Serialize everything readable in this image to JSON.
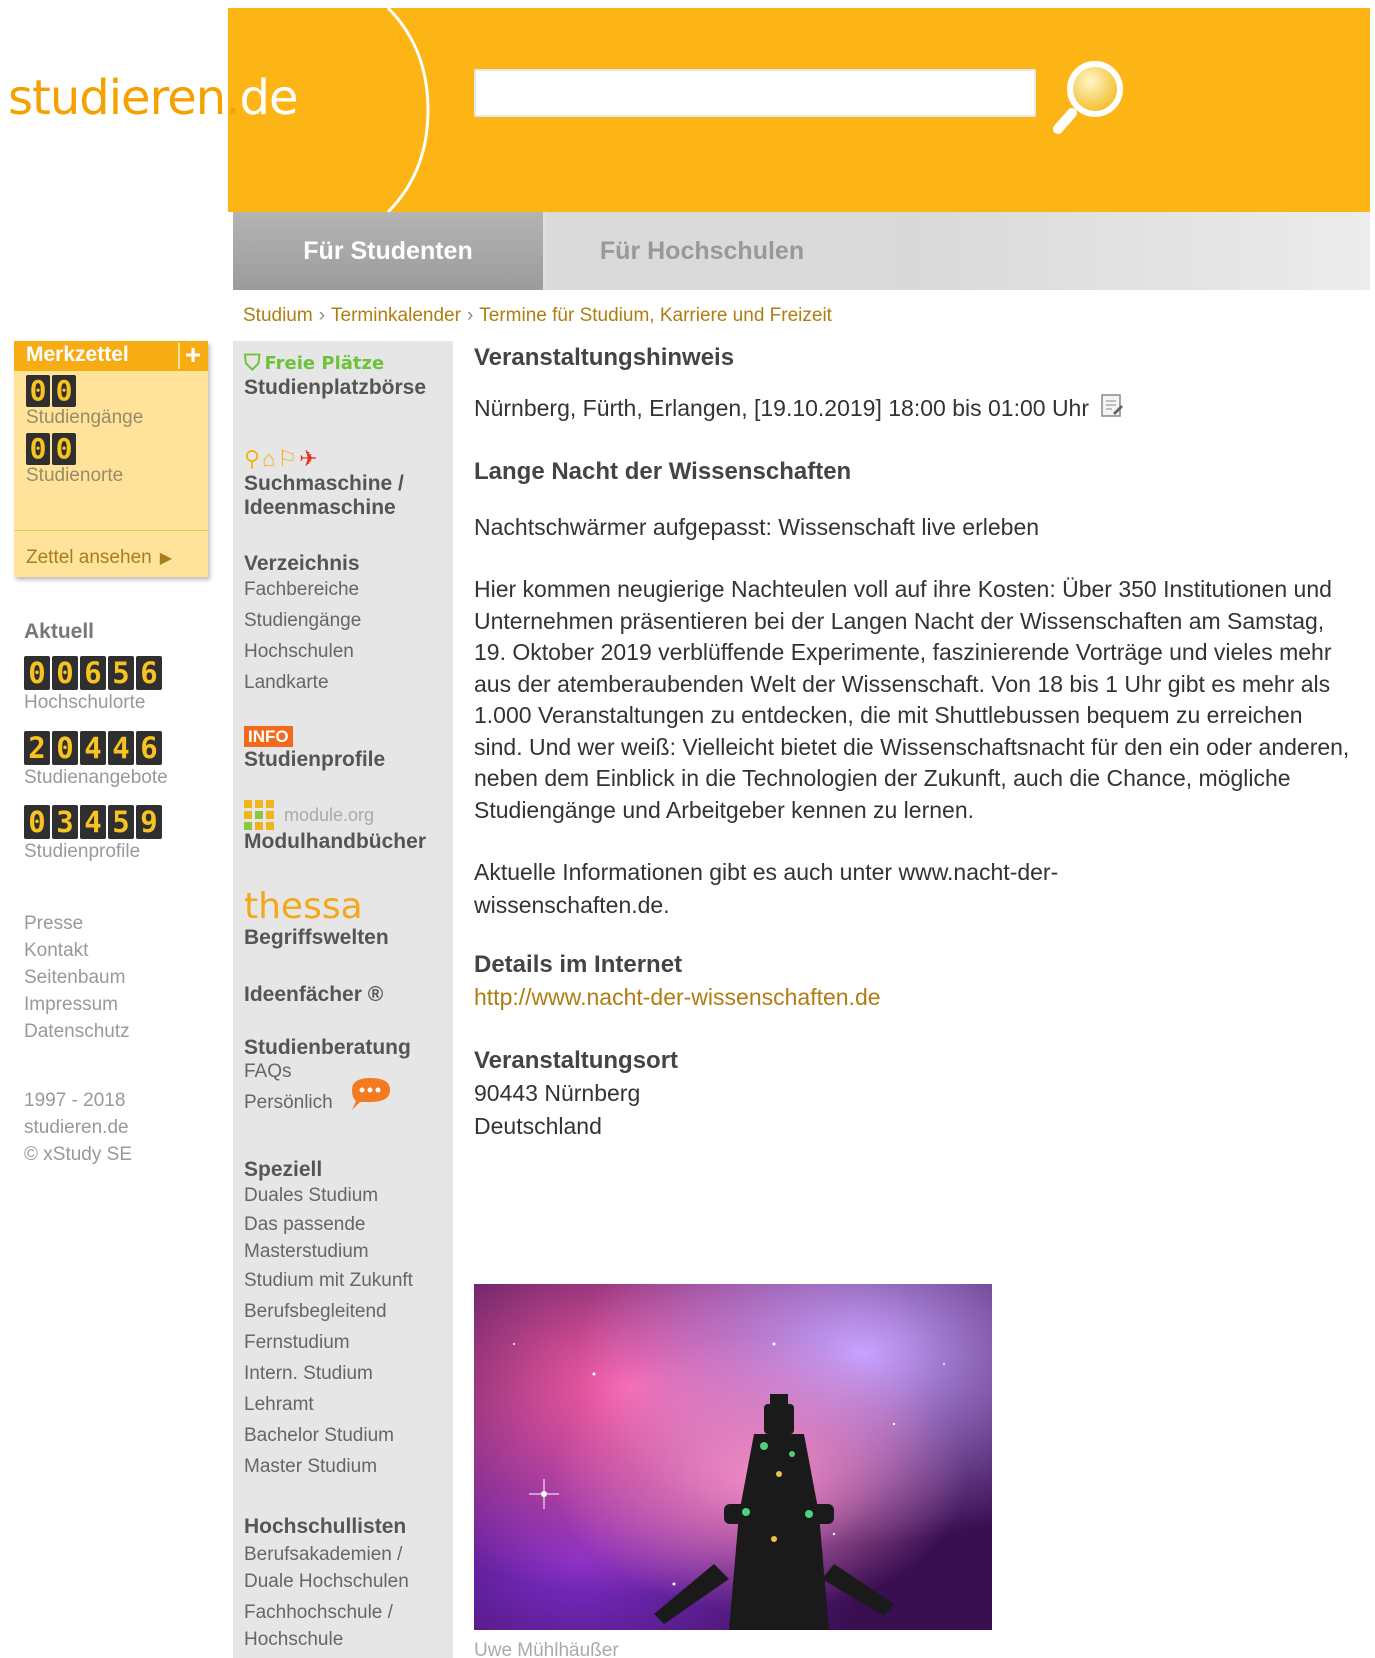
{
  "header": {
    "logo_main": "studieren.",
    "logo_tld": "de",
    "search_placeholder": ""
  },
  "tabs": [
    {
      "label": "Für Studenten",
      "active": true
    },
    {
      "label": "Für Hochschulen",
      "active": false
    }
  ],
  "breadcrumb": [
    "Studium",
    "Terminkalender",
    "Termine für Studium, Karriere und Freizeit"
  ],
  "merkzettel": {
    "title": "Merkzettel",
    "plus": "+",
    "studiengaenge_count": "00",
    "studiengaenge_label": "Studiengänge",
    "studienorte_count": "00",
    "studienorte_label": "Studienorte",
    "link": "Zettel ansehen"
  },
  "aktuell": {
    "title": "Aktuell",
    "stats": [
      {
        "value": "00656",
        "label": "Hochschulorte"
      },
      {
        "value": "20446",
        "label": "Studienangebote"
      },
      {
        "value": "03459",
        "label": "Studienprofile"
      }
    ]
  },
  "footer_links": [
    "Presse",
    "Kontakt",
    "Seitenbaum",
    "Impressum",
    "Datenschutz"
  ],
  "copyright": [
    "1997 - 2018",
    "studieren.de",
    "© xStudy SE"
  ],
  "nav": {
    "freie_plaetze": "Freie Plätze",
    "studienplatzboerse": "Studienplatzbörse",
    "suchmaschine": "Suchmaschine /",
    "ideenmaschine": "Ideenmaschine",
    "verzeichnis": {
      "title": "Verzeichnis",
      "items": [
        "Fachbereiche",
        "Studiengänge",
        "Hochschulen",
        "Landkarte"
      ]
    },
    "info_badge": "INFO",
    "studienprofile": "Studienprofile",
    "module_org": "module.org",
    "modulhandbuecher": "Modulhandbücher",
    "thessa": "thessa",
    "begriffswelten": "Begriffswelten",
    "ideenfaecher": "Ideenfächer ®",
    "studienberatung": {
      "title": "Studienberatung",
      "items": [
        "FAQs",
        "Persönlich"
      ]
    },
    "speziell": {
      "title": "Speziell",
      "items": [
        "Duales Studium",
        "Das passende Masterstudium",
        "Studium mit Zukunft",
        "Berufsbegleitend",
        "Fernstudium",
        "Intern. Studium",
        "Lehramt",
        "Bachelor Studium",
        "Master Studium"
      ]
    },
    "hochschullisten": {
      "title": "Hochschullisten",
      "items": [
        "Berufsakademien / Duale Hochschulen",
        "Fachhochschule / Hochschule"
      ]
    }
  },
  "event": {
    "heading": "Veranstaltungshinweis",
    "when": "Nürnberg, Fürth, Erlangen, [19.10.2019] 18:00 bis 01:00 Uhr",
    "title": "Lange Nacht der Wissenschaften",
    "subtitle": "Nachtschwärmer aufgepasst: Wissenschaft live erleben",
    "body": "Hier kommen neugierige Nachteulen voll auf ihre Kosten: Über 350 Institutionen und Unternehmen präsentieren bei der Langen Nacht der Wissenschaften am Samstag, 19. Oktober 2019 verblüffende Experimente, faszinierende Vorträge und vieles mehr aus der atemberaubenden Welt der Wissenschaft. Von 18 bis 1 Uhr gibt es mehr als 1.000 Veranstaltungen zu entdecken, die mit Shuttlebussen bequem zu erreichen sind. Und wer weiß: Vielleicht bietet die Wissenschaftsnacht für den ein oder anderen, neben dem Einblick in die Technologien der Zukunft, auch die Chance, mögliche Studiengänge und Arbeitgeber kennen zu lernen.",
    "info": "Aktuelle Informationen gibt es auch unter www.nacht-der-wissenschaften.de.",
    "details_heading": "Details im Internet",
    "url": "http://www.nacht-der-wissenschaften.de",
    "ort_heading": "Veranstaltungsort",
    "ort_line1": "90443 Nürnberg",
    "ort_line2": "Deutschland",
    "photo_credit": "Uwe Mühlhäußer"
  },
  "colors": {
    "brand_orange": "#fdb515",
    "merkzettel_bg": "#ffe39b",
    "link_gold": "#b07d10",
    "nav_bg": "#e6e6e6"
  }
}
